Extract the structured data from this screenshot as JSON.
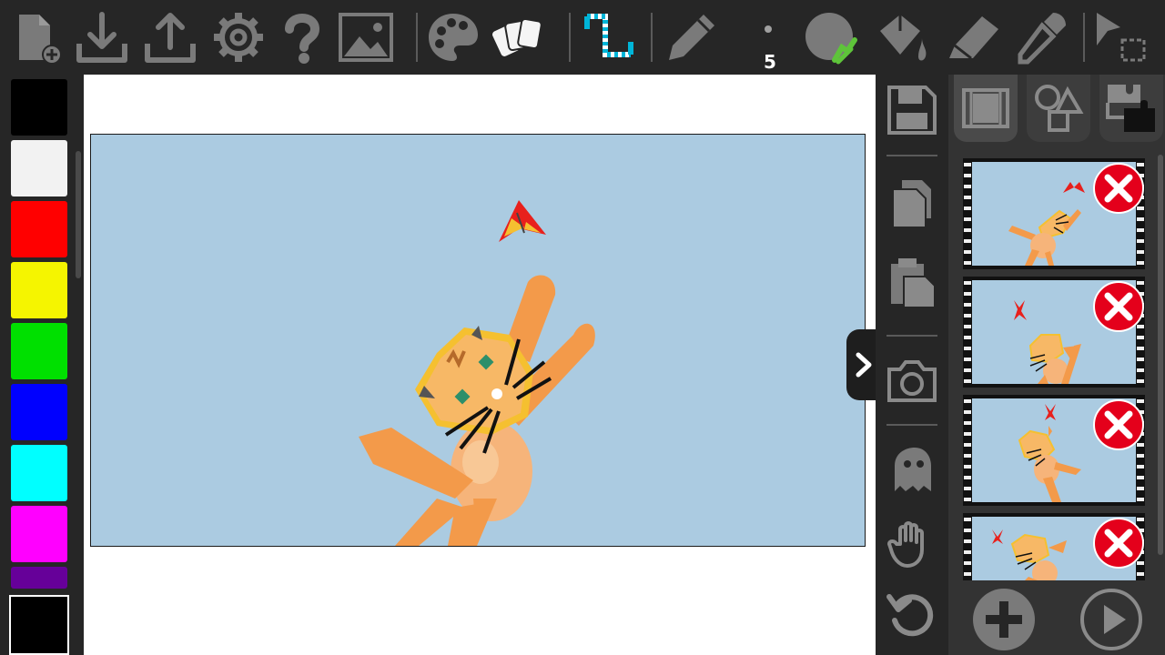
{
  "toolbar": {
    "brush_size": "5",
    "tools": [
      "new-file-icon",
      "download-icon",
      "upload-icon",
      "gear-icon",
      "help-icon",
      "image-icon",
      "palette-icon",
      "cards-icon",
      "animation-icon",
      "pencil-icon",
      "brush-size",
      "circle-fill-icon",
      "paint-bucket-icon",
      "eraser-icon",
      "eyedropper-icon",
      "select-icon"
    ]
  },
  "palette": {
    "colors": [
      "#000000",
      "#f2f2f2",
      "#ff0000",
      "#f5f500",
      "#00e000",
      "#0000ff",
      "#00ffff",
      "#ff00ff",
      "#660099"
    ],
    "current_color": "#000000"
  },
  "sidebar": {
    "buttons": [
      "save-icon",
      "copy-icon",
      "paste-icon",
      "camera-icon",
      "ghost-icon",
      "hand-icon",
      "undo-icon"
    ]
  },
  "frames_panel": {
    "tabs": [
      "film-strip-icon",
      "shapes-icon",
      "puzzle-icon"
    ],
    "frames": 4
  },
  "colors": {
    "toolbar_bg": "#262626",
    "scene_bg": "#abcbe1",
    "cat_orange": "#f39a4a",
    "delete_red": "#e4001b"
  }
}
